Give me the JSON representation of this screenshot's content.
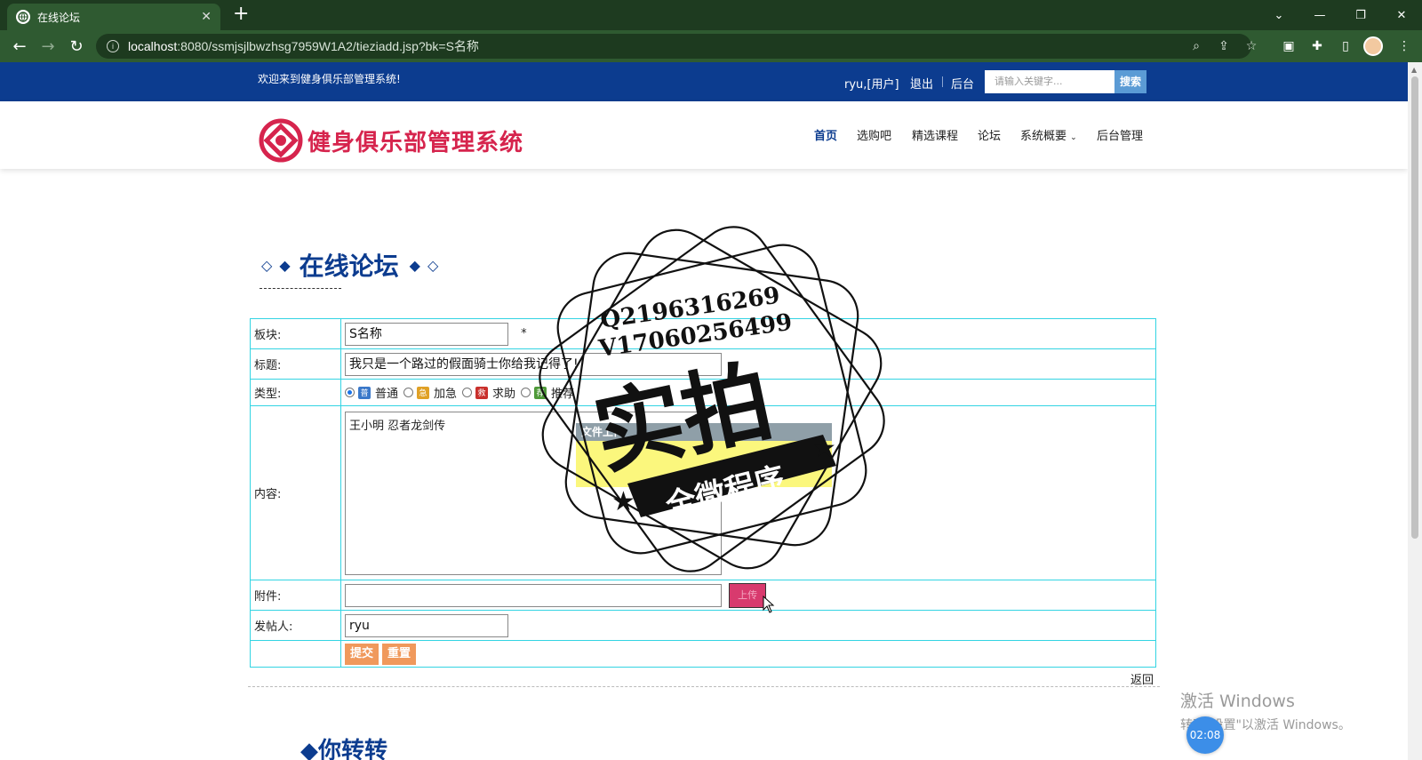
{
  "browser": {
    "tab_title": "在线论坛",
    "url_host": "localhost",
    "url_rest": ":8080/ssmjsjlbwzhsg7959W1A2/tieziadd.jsp?bk=S名称"
  },
  "topbar": {
    "welcome": "欢迎来到健身俱乐部管理系统!",
    "user": "ryu,[用户]",
    "logout": "退出",
    "admin": "后台",
    "search_placeholder": "请输入关键字...",
    "search_button": "搜索"
  },
  "header": {
    "brand": "健身俱乐部管理系统",
    "nav": [
      "首页",
      "选购吧",
      "精选课程",
      "论坛",
      "系统概要",
      "后台管理"
    ]
  },
  "page": {
    "section_title": "在线论坛",
    "form": {
      "board_label": "板块:",
      "board_value": "S名称",
      "required_mark": "*",
      "title_label": "标题:",
      "title_value": "我只是一个路过的假面骑士你给我记得了!",
      "type_label": "类型:",
      "types": [
        "普通",
        "加急",
        "求助",
        "推荐"
      ],
      "type_icons": [
        "普",
        "急",
        "救",
        "荐"
      ],
      "selected_type": "普通",
      "content_label": "内容:",
      "content_value": "王小明 忍者龙剑传",
      "attachment_label": "附件:",
      "upload_button": "上传",
      "poster_label": "发帖人:",
      "poster_value": "ryu",
      "submit": "提交",
      "reset": "重置"
    },
    "back": "返回",
    "next_title_fragment": "◆你转转"
  },
  "overlay": {
    "upload_dialog_title": "文件上传",
    "stamp_q": "Q2196316269",
    "stamp_v": "V17060256499",
    "stamp_main": "实拍",
    "stamp_banner": "全微程序"
  },
  "os": {
    "activate_line1": "激活 Windows",
    "activate_line2": "转到\"设置\"以激活 Windows。",
    "timer": "02:08"
  },
  "colors": {
    "brand_blue": "#0c3c8f",
    "brand_red": "#d6244d",
    "table_border": "#33d4e3",
    "button_orange": "#f0995c",
    "chrome_green": "#2f5a31"
  }
}
